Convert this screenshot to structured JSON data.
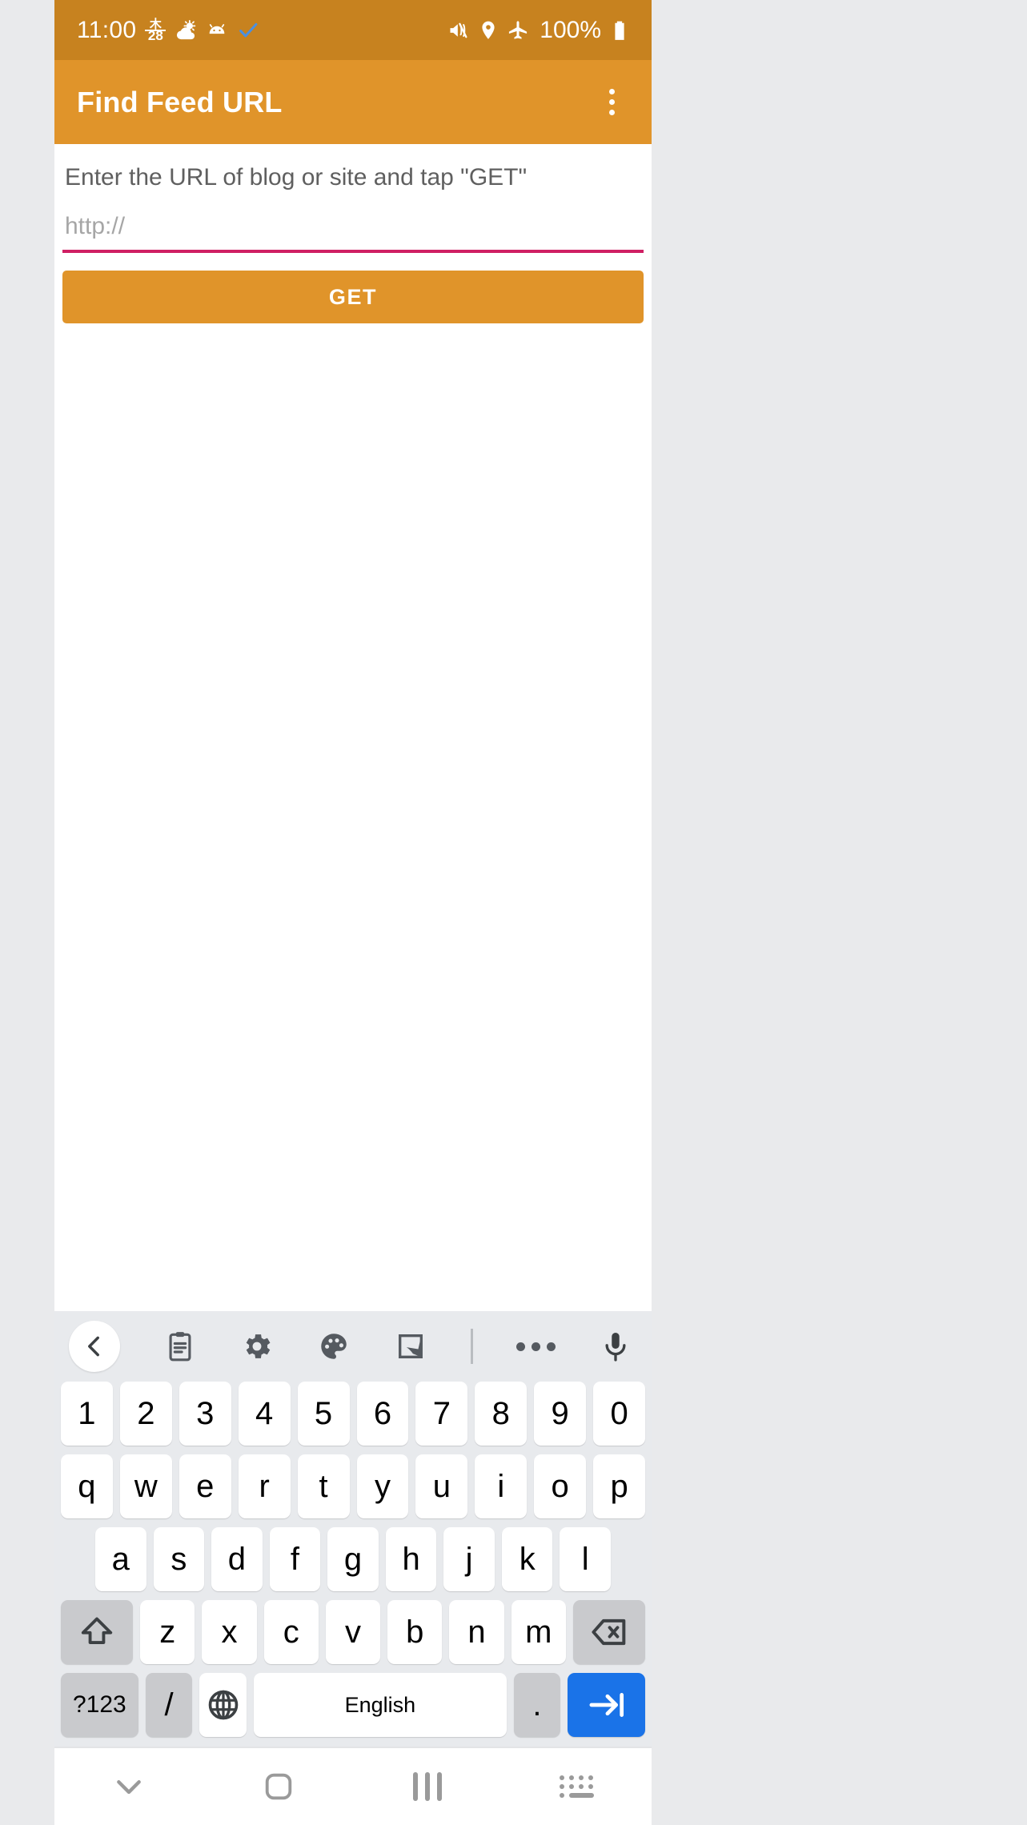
{
  "status_bar": {
    "time": "11:00",
    "calendar_day": "28",
    "calendar_kanji": "木",
    "battery_percent": "100%",
    "left_icons": [
      "calendar-icon",
      "weather-partly-cloudy-icon",
      "android-head-icon",
      "check-icon"
    ],
    "right_icons": [
      "mute-vibrate-icon",
      "location-pin-icon",
      "airplane-mode-icon",
      "battery-full-icon"
    ],
    "background_color": "#c7821f"
  },
  "app_bar": {
    "title": "Find Feed URL",
    "overflow_label": "More options",
    "background_color": "#e0942a"
  },
  "form": {
    "hint": "Enter the URL of blog or site and tap \"GET\"",
    "url_placeholder": "http://",
    "url_value": "",
    "underline_color": "#cf1f63",
    "get_label": "GET",
    "get_color": "#e0942a"
  },
  "keyboard": {
    "toolbar": [
      "back-chevron-icon",
      "clipboard-icon",
      "gear-icon",
      "palette-icon",
      "handwriting-icon",
      "divider",
      "more-options-icon",
      "microphone-icon"
    ],
    "row_numbers": [
      "1",
      "2",
      "3",
      "4",
      "5",
      "6",
      "7",
      "8",
      "9",
      "0"
    ],
    "row_top": [
      "q",
      "w",
      "e",
      "r",
      "t",
      "y",
      "u",
      "i",
      "o",
      "p"
    ],
    "row_home": [
      "a",
      "s",
      "d",
      "f",
      "g",
      "h",
      "j",
      "k",
      "l"
    ],
    "row_bottom": [
      "z",
      "x",
      "c",
      "v",
      "b",
      "n",
      "m"
    ],
    "shift_label": "shift-icon",
    "backspace_label": "backspace-icon",
    "symbols_label": "?123",
    "slash_label": "/",
    "globe_label": "globe-icon",
    "space_label": "English",
    "period_label": ".",
    "enter_label": "→|",
    "enter_color": "#1a73e8"
  },
  "nav_bar": {
    "items": [
      "keyboard-dismiss-icon",
      "home-icon",
      "recents-icon",
      "keyboard-switch-icon"
    ]
  }
}
